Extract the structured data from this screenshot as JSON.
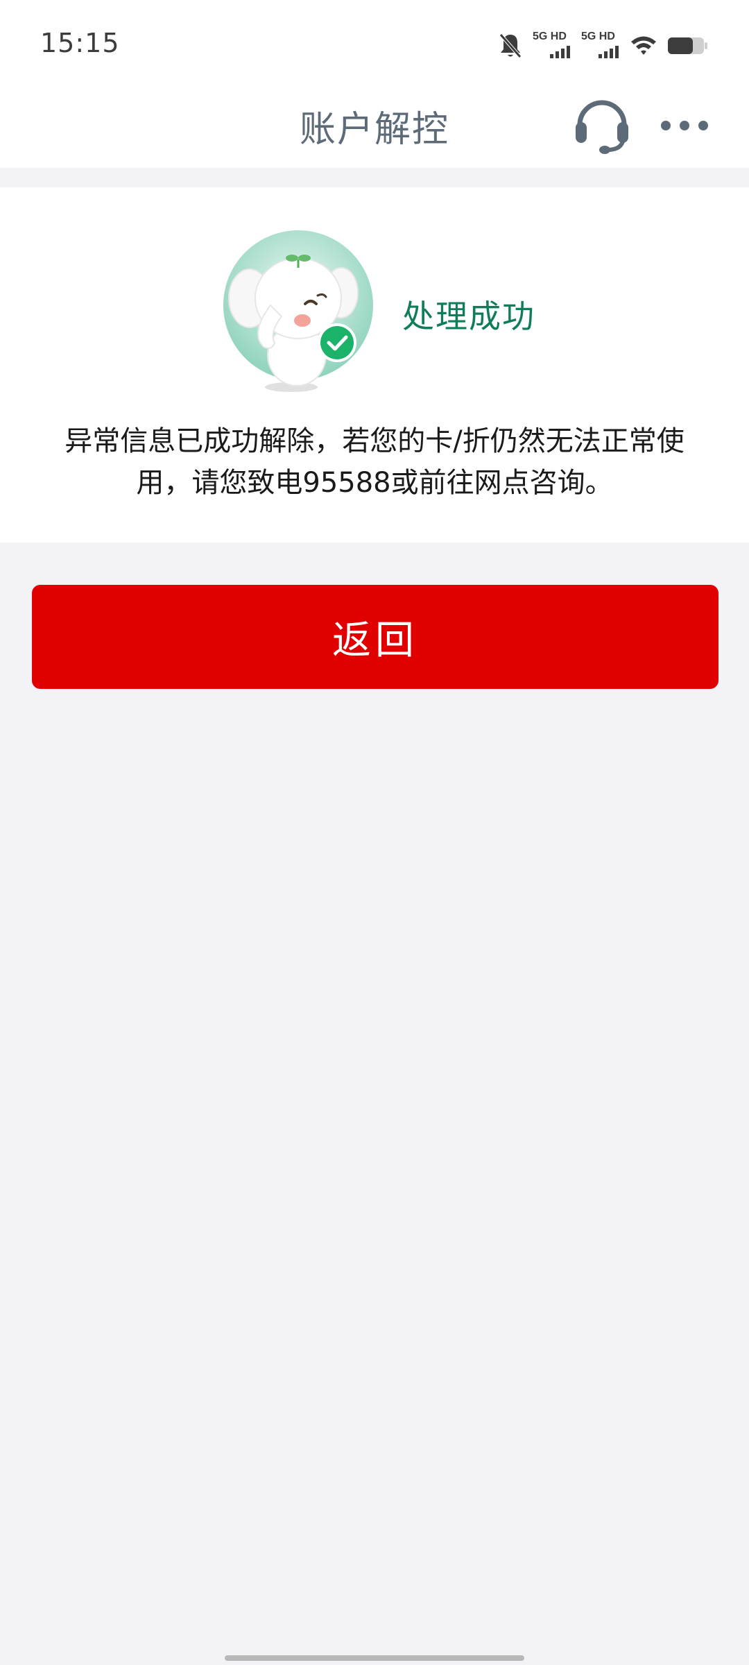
{
  "status_bar": {
    "time": "15:15",
    "signal_1_label": "5G HD",
    "signal_2_label": "5G HD"
  },
  "nav": {
    "title": "账户解控",
    "service_icon": "headset-icon",
    "more_icon": "more-icon"
  },
  "result": {
    "status": "处理成功",
    "message": "异常信息已成功解除，若您的卡/折仍然无法正常使用，请您致电95588或前往网点咨询。",
    "status_color": "#0f7d5a"
  },
  "actions": {
    "back_label": "返回",
    "back_color": "#e00000"
  }
}
